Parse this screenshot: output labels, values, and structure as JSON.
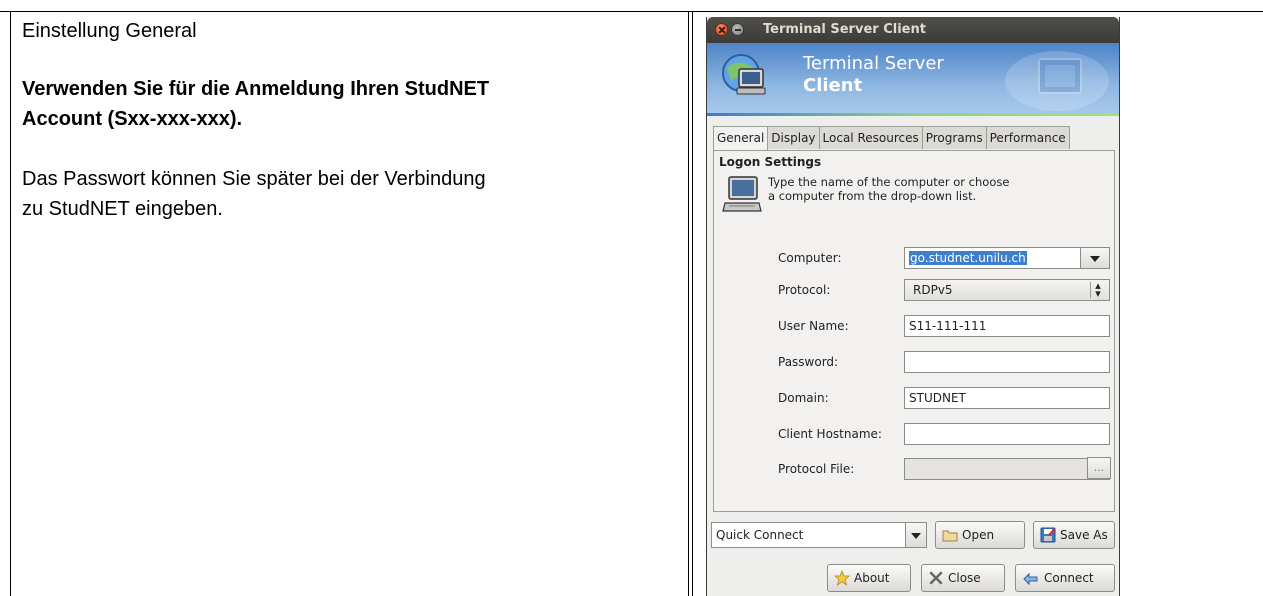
{
  "document": {
    "heading": "Einstellung General",
    "bold_line1": "Verwenden Sie für die Anmeldung Ihren StudNET",
    "bold_line2": "Account (Sxx-xxx-xxx).",
    "text_line1": "Das Passwort können Sie später bei der Verbindung",
    "text_line2": "zu StudNET eingeben."
  },
  "window": {
    "title": "Terminal Server Client",
    "banner_line1": "Terminal Server",
    "banner_line2": "Client"
  },
  "tabs": [
    {
      "label": "General",
      "active": true
    },
    {
      "label": "Display",
      "active": false
    },
    {
      "label": "Local Resources",
      "active": false
    },
    {
      "label": "Programs",
      "active": false
    },
    {
      "label": "Performance",
      "active": false
    }
  ],
  "logon": {
    "section_title": "Logon Settings",
    "info_line1": "Type the name of the computer or choose",
    "info_line2": "a computer from the drop-down list.",
    "computer_label": "Computer:",
    "computer_value": "go.studnet.unilu.ch",
    "protocol_label": "Protocol:",
    "protocol_value": "RDPv5",
    "username_label": "User Name:",
    "username_value": "S11-111-111",
    "password_label": "Password:",
    "password_value": "",
    "domain_label": "Domain:",
    "domain_value": "STUDNET",
    "hostname_label": "Client Hostname:",
    "hostname_value": "",
    "protocol_file_label": "Protocol File:",
    "protocol_file_value": "",
    "browse_label": "..."
  },
  "bottom": {
    "quick_connect": "Quick Connect",
    "open": "Open",
    "save_as": "Save As",
    "about": "About",
    "close": "Close",
    "connect": "Connect"
  },
  "icons": {
    "close": "close-icon",
    "minimize": "minimize-icon",
    "computer": "computer-icon",
    "folder": "folder-icon",
    "save": "save-icon",
    "star": "star-icon",
    "scissors": "close-x-icon",
    "connect": "connect-icon"
  }
}
